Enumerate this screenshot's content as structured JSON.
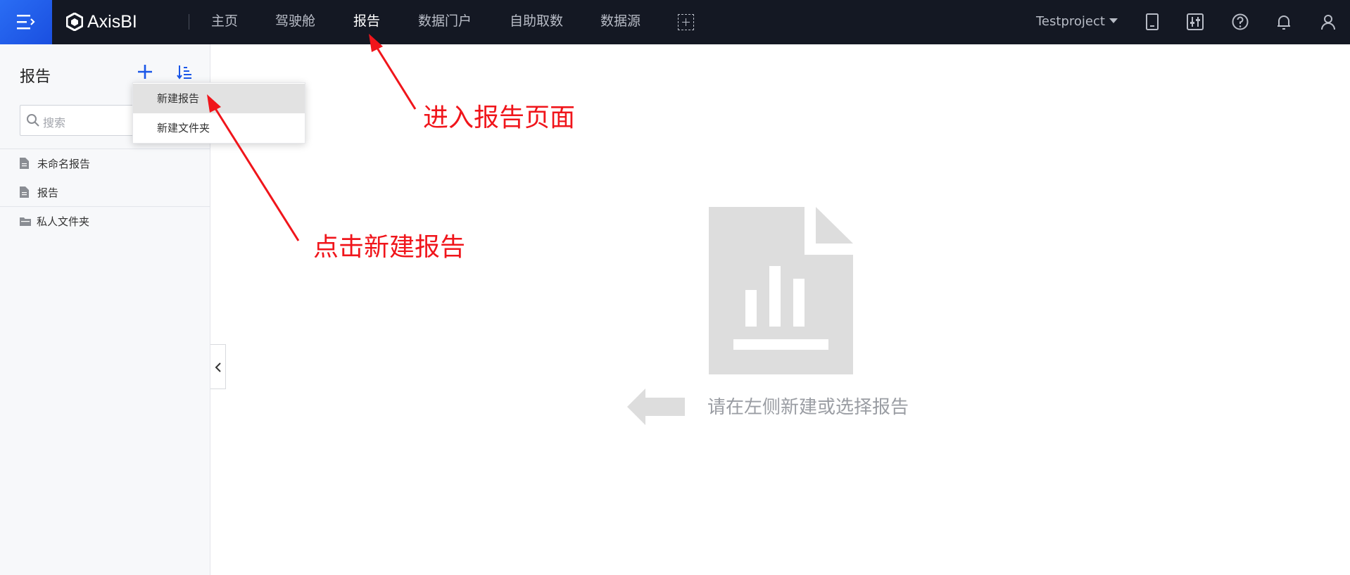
{
  "app": {
    "logo_text": "AxisBI",
    "project": "Testproject"
  },
  "nav": {
    "items": [
      "主页",
      "驾驶舱",
      "报告",
      "数据门户",
      "自助取数",
      "数据源"
    ],
    "active": "报告"
  },
  "topbar_icons": [
    "tablet-icon",
    "sliders-icon",
    "help-icon",
    "bell-icon",
    "user-icon"
  ],
  "sidebar": {
    "title": "报告",
    "search_placeholder": "搜索",
    "items": [
      {
        "label": "未命名报告",
        "icon": "document-icon"
      },
      {
        "label": "报告",
        "icon": "document-icon"
      }
    ],
    "folders": [
      {
        "label": "私人文件夹",
        "icon": "folder-icon"
      }
    ]
  },
  "dropdown": {
    "items": [
      "新建报告",
      "新建文件夹"
    ],
    "highlighted": "新建报告"
  },
  "main": {
    "empty_message": "请在左侧新建或选择报告"
  },
  "annotations": {
    "nav_note": "进入报告页面",
    "create_note": "点击新建报告",
    "color": "#f0151b"
  },
  "colors": {
    "topbar": "#141823",
    "accent": "#2a6df4",
    "placeholder_art": "#dddddd"
  }
}
